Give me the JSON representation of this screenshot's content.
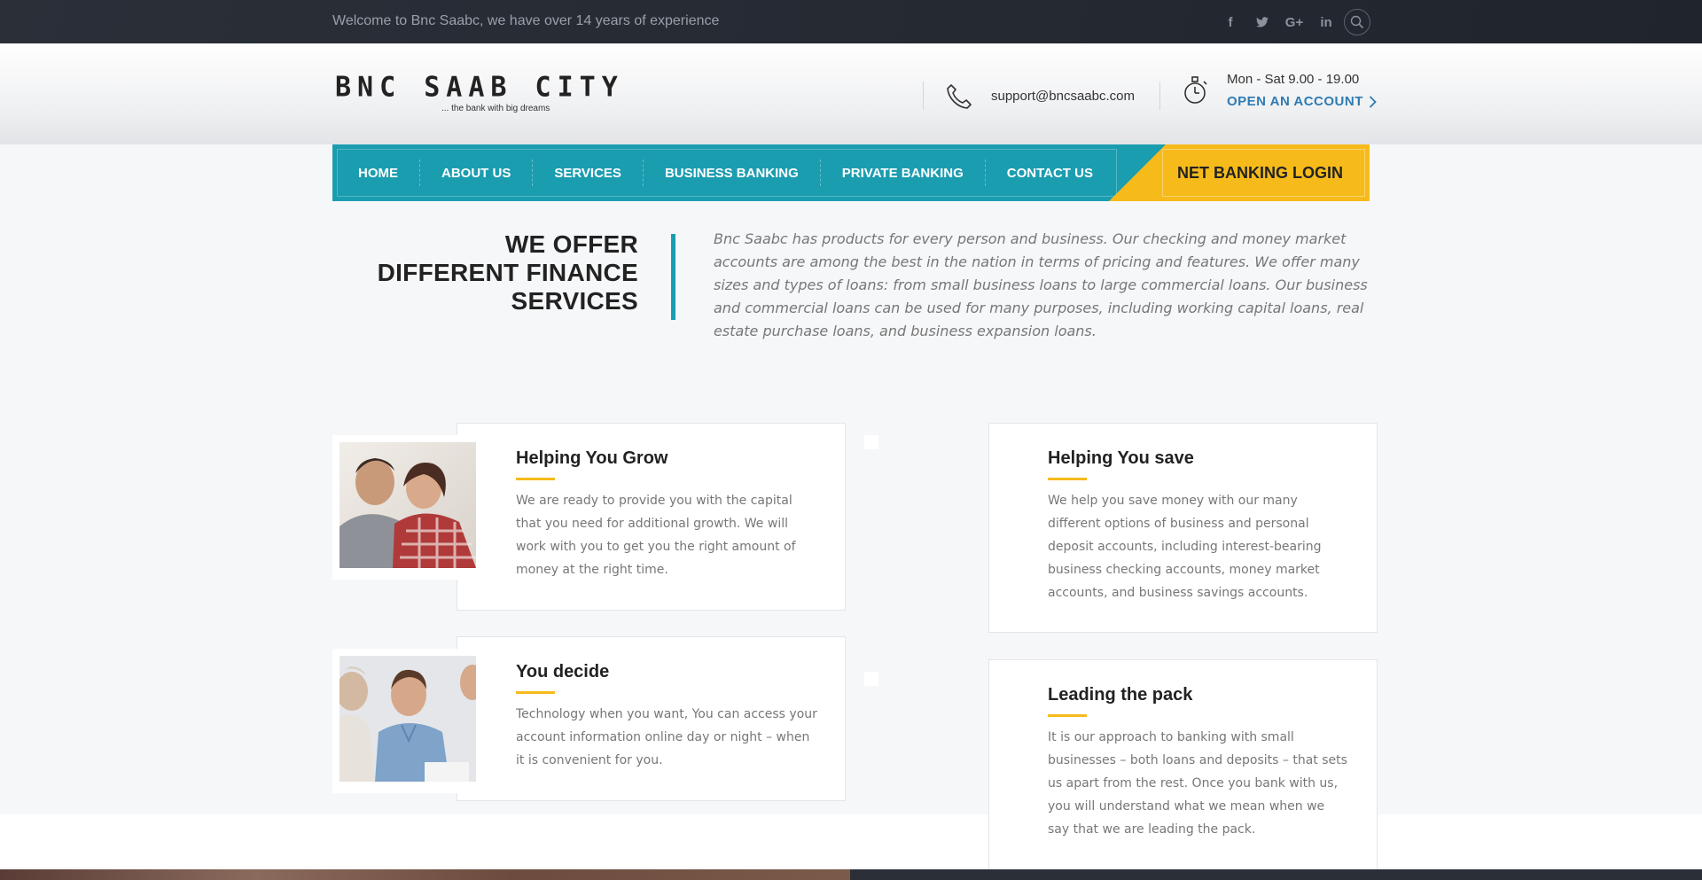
{
  "topbar": {
    "welcome": "Welcome to Bnc Saabc, we have over 14 years of experience",
    "socials": [
      "f",
      "t",
      "G+",
      "in"
    ],
    "social_icons": [
      "facebook-icon",
      "twitter-icon",
      "google-plus-icon",
      "linkedin-icon"
    ],
    "search_icon": "search-icon"
  },
  "header": {
    "logo_name": "BNC SAAB CITY",
    "logo_tagline": "... the bank with big dreams",
    "email": "support@bncsaabc.com",
    "hours": "Mon - Sat 9.00 - 19.00",
    "open_account": "OPEN AN ACCOUNT"
  },
  "nav": {
    "items": [
      "HOME",
      "ABOUT US",
      "SERVICES",
      "BUSINESS BANKING",
      "PRIVATE BANKING",
      "CONTACT US"
    ],
    "login": "NET BANKING LOGIN"
  },
  "offer": {
    "title_lines": [
      "WE OFFER",
      "DIFFERENT FINANCE",
      "SERVICES"
    ],
    "text": "Bnc Saabc has products for every person and business. Our checking and money market accounts are among the best in the nation in terms of pricing and features. We offer many sizes and types of loans: from small business loans to large commercial loans. Our business and commercial loans can be used for many purposes, including working capital loans, real estate purchase loans, and business expansion loans."
  },
  "cards": [
    {
      "title": "Helping You Grow",
      "text": "We are ready to provide you with the capital that you need for additional growth. We will work with you to get you the right amount of money at the right time."
    },
    {
      "title": "Helping You save",
      "text": "We help you save money with our many different options of business and personal deposit accounts, including interest-bearing business checking accounts, money market accounts, and business savings accounts."
    },
    {
      "title": "You decide",
      "text": "Technology when you want, You can access your account information online day or night – when it is convenient for you."
    },
    {
      "title": "Leading the pack",
      "text": "It is our approach to banking with small businesses – both loans and deposits – that sets us apart from the rest. Once you bank with us, you will understand what we mean when we say that we are leading the pack."
    }
  ],
  "colors": {
    "accent_teal": "#1b9db0",
    "accent_yellow": "#f6bb1b",
    "link_blue": "#2e7bb3",
    "topbar_dark": "#252a33"
  }
}
